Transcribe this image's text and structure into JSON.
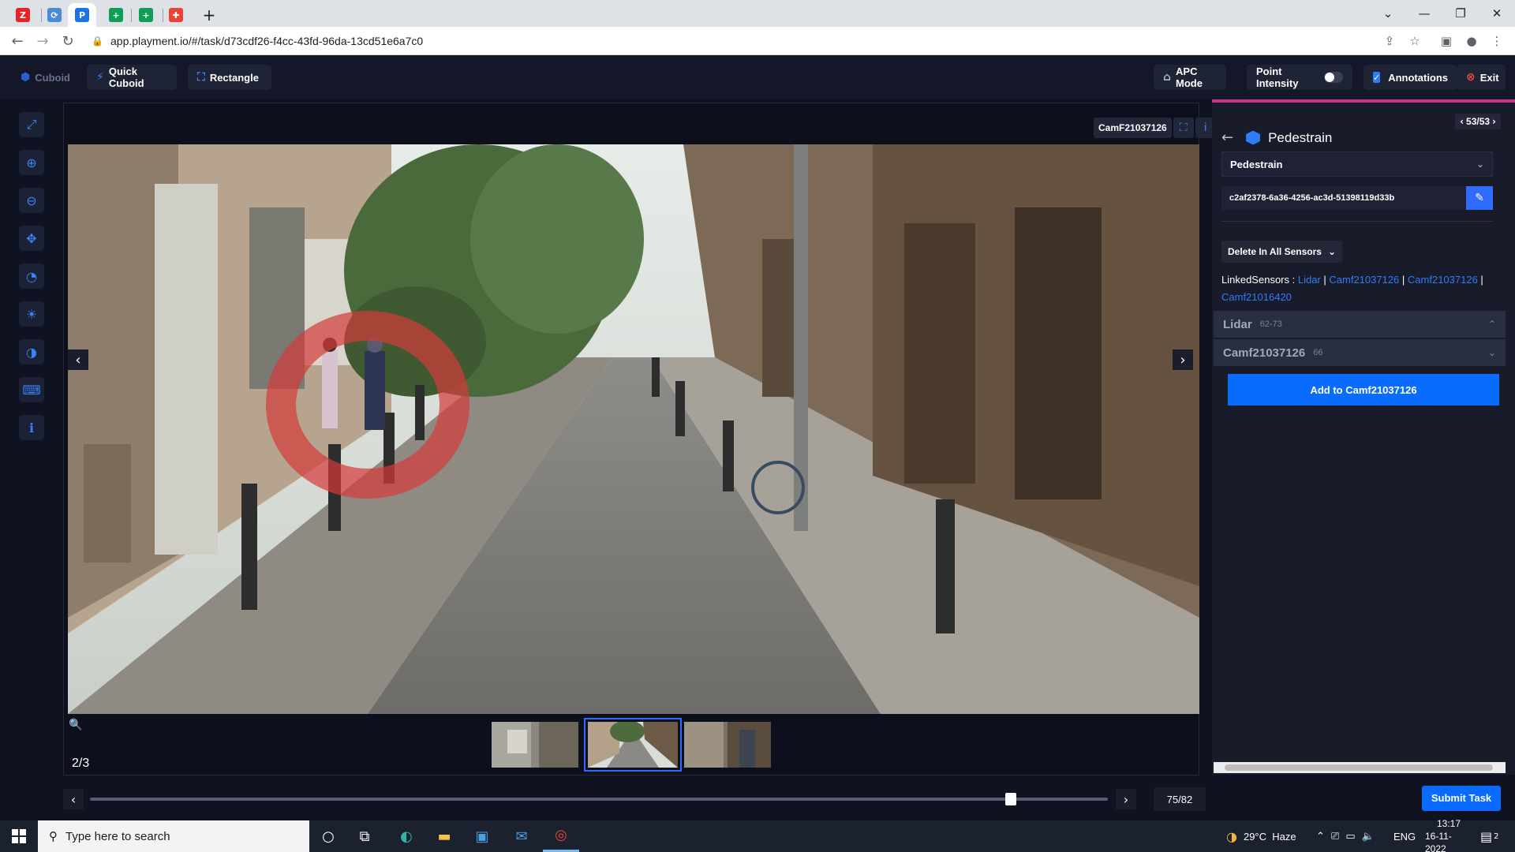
{
  "browser": {
    "tabs": [
      {
        "icon": "zoho-icon",
        "label": "Z",
        "color": "#e42527"
      },
      {
        "icon": "tab-app-icon",
        "label": "⟳",
        "color": "#4b8bd6"
      },
      {
        "icon": "playment-icon",
        "label": "P",
        "color": "#1a73e8"
      },
      {
        "icon": "sheets-icon",
        "label": "+",
        "color": "#0f9d58"
      },
      {
        "icon": "sheets-icon",
        "label": "+",
        "color": "#0f9d58"
      },
      {
        "icon": "extension-icon",
        "label": "✚",
        "color": "#ea4335"
      }
    ],
    "new_tab": "+",
    "url": "app.playment.io/#/task/d73cdf26-f4cc-43fd-96da-13cd51e6a7c0"
  },
  "toolbar": {
    "cuboid": "Cuboid",
    "quick_cuboid": "Quick Cuboid",
    "rectangle": "Rectangle",
    "apc_mode": "APC Mode",
    "point_intensity": "Point Intensity",
    "annotations": "Annotations",
    "exit": "Exit"
  },
  "viewer": {
    "camera_label": "CamF21037126",
    "frame_counter": "2/3"
  },
  "panel": {
    "page": "53/53",
    "title": "Pedestrain",
    "class_select": "Pedestrain",
    "object_id": "c2af2378-6a36-4256-ac3d-51398119d33b",
    "delete_label": "Delete In All Sensors",
    "linked_label": "LinkedSensors :",
    "linked_sensors": [
      "Lidar",
      "Camf21037126",
      "Camf21037126",
      "Camf21016420"
    ],
    "sections": [
      {
        "name": "Lidar",
        "range": "62-73"
      },
      {
        "name": "Camf21037126",
        "range": "66"
      }
    ],
    "add_button": "Add to Camf21037126"
  },
  "timeline": {
    "frame": "75/82",
    "position_fraction": 0.905,
    "submit": "Submit Task"
  },
  "taskbar": {
    "search_placeholder": "Type here to search",
    "weather": "29°C  Haze",
    "language": "ENG",
    "time": "13:17",
    "date": "16-11-2022",
    "notifications": "2"
  },
  "colors": {
    "accent": "#0a6cff",
    "link": "#2f7cf6",
    "panel_border": "#c2378a"
  }
}
